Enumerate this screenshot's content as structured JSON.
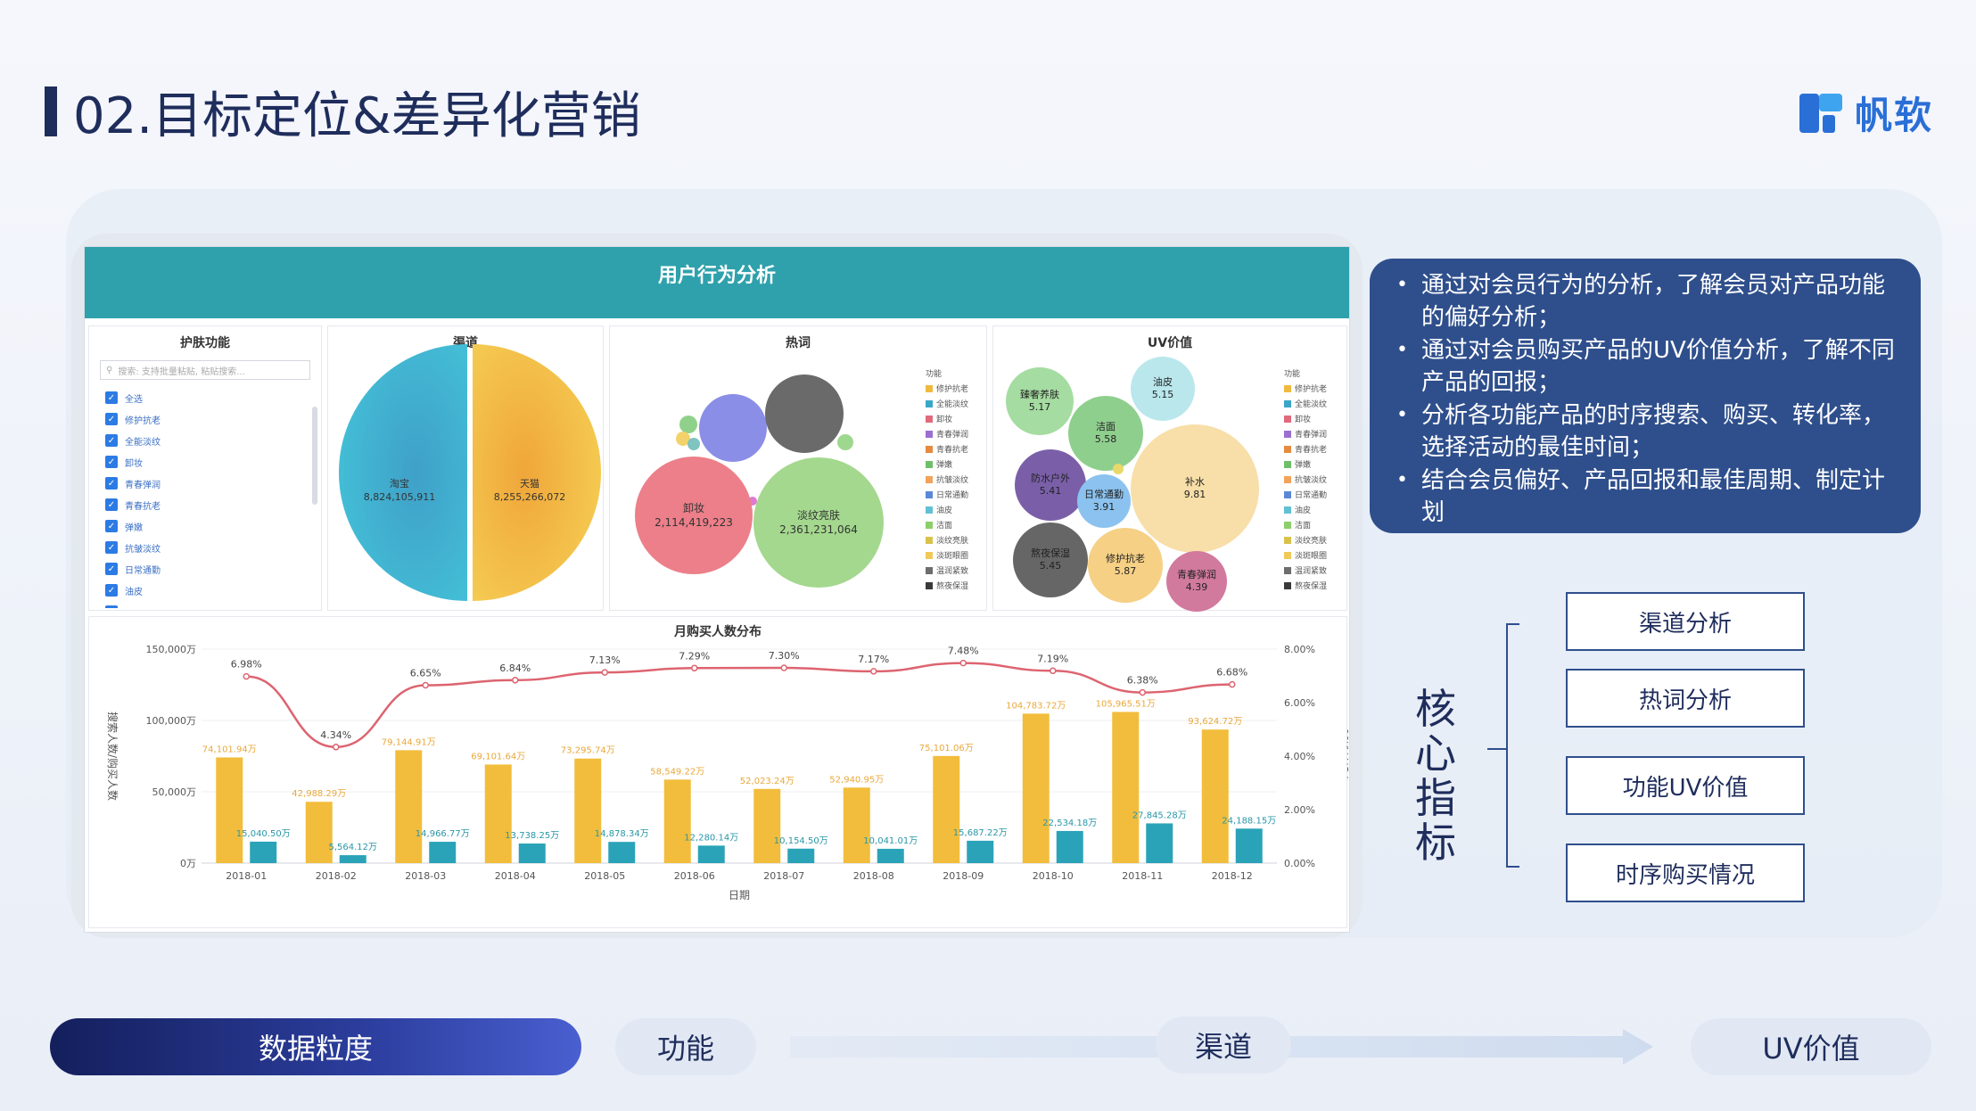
{
  "slide": {
    "title": "02.目标定位&差异化营销",
    "logo_text": "帆软"
  },
  "dashboard": {
    "title": "用户行为分析",
    "filter": {
      "title": "护肤功能",
      "search_placeholder": "搜索: 支持批量粘贴, 粘贴搜索...",
      "items": [
        "全选",
        "修护抗老",
        "全能淡纹",
        "卸妆",
        "青春弹润",
        "青春抗老",
        "弹嫩",
        "抗皱淡纹",
        "日常通勤",
        "油皮",
        "洁面"
      ]
    },
    "channel": {
      "title": "渠道",
      "slices": [
        {
          "label": "淘宝",
          "value": "8,824,105,911"
        },
        {
          "label": "天猫",
          "value": "8,255,266,072"
        }
      ]
    },
    "hotwords": {
      "title": "热词",
      "legend_title": "功能",
      "bubbles": [
        {
          "label": "卸妆",
          "value": "2,114,419,223"
        },
        {
          "label": "淡纹亮肤",
          "value": "2,361,231,064"
        }
      ]
    },
    "uv": {
      "title": "UV价值",
      "legend_title": "功能",
      "bubbles": [
        {
          "label": "臻奢养肤",
          "value": "5.17"
        },
        {
          "label": "油皮",
          "value": "5.15"
        },
        {
          "label": "洁面",
          "value": "5.58"
        },
        {
          "label": "防水户外",
          "value": "5.41"
        },
        {
          "label": "日常通勤",
          "value": "3.91"
        },
        {
          "label": "补水",
          "value": "9.81"
        },
        {
          "label": "熬夜保湿",
          "value": "5.45"
        },
        {
          "label": "修护抗老",
          "value": "5.87"
        },
        {
          "label": "青春弹润",
          "value": "4.39"
        }
      ]
    },
    "legend_items": [
      "修护抗老",
      "全能淡纹",
      "卸妆",
      "青春弹润",
      "青春抗老",
      "弹嫩",
      "抗皱淡纹",
      "日常通勤",
      "油皮",
      "洁面",
      "淡纹亮肤",
      "淡斑眼圈",
      "温润紧致",
      "熬夜保湿"
    ],
    "monthly": {
      "title": "月购买人数分布"
    }
  },
  "colors": {
    "legend": [
      "#f0b93f",
      "#3aa7c7",
      "#e06a7b",
      "#9b6fd0",
      "#e58a3e",
      "#6fbf6a",
      "#f2a35b",
      "#5a88d6",
      "#62c0d4",
      "#8ccf6a",
      "#d8c24a",
      "#f0c95a",
      "#6d6d6d",
      "#3a3a3a"
    ],
    "bar_search": "#f2bd3c",
    "bar_buy": "#2aa3b8",
    "line": "#dd6470",
    "header": "#2fa1ac"
  },
  "chart_data": {
    "type": "bar",
    "title": "月购买人数分布",
    "xlabel": "日期",
    "ylabel": "搜索人数/购买人数",
    "y2label": "支付转化率",
    "ylim": [
      0,
      150000
    ],
    "y2lim": [
      0,
      8
    ],
    "y_ticks": [
      "0万",
      "50,000万",
      "100,000万",
      "150,000万"
    ],
    "y2_ticks": [
      "0.00%",
      "2.00%",
      "4.00%",
      "6.00%",
      "8.00%"
    ],
    "categories": [
      "2018-01",
      "2018-02",
      "2018-03",
      "2018-04",
      "2018-05",
      "2018-06",
      "2018-07",
      "2018-08",
      "2018-09",
      "2018-10",
      "2018-11",
      "2018-12"
    ],
    "series": [
      {
        "name": "搜索人数",
        "values": [
          74101.94,
          42988.29,
          79144.91,
          69101.64,
          73295.74,
          58549.22,
          52023.24,
          52940.95,
          75101.06,
          104783.72,
          105965.51,
          93624.72
        ],
        "labels": [
          "74,101.94万",
          "42,988.29万",
          "79,144.91万",
          "69,101.64万",
          "73,295.74万",
          "58,549.22万",
          "52,023.24万",
          "52,940.95万",
          "75,101.06万",
          "104,783.72万",
          "105,965.51万",
          "93,624.72万"
        ]
      },
      {
        "name": "购买人数",
        "values": [
          15040.5,
          5564.12,
          14966.77,
          13738.25,
          14878.34,
          12280.14,
          10154.5,
          10041.01,
          15687.22,
          22534.18,
          27845.28,
          24188.15
        ],
        "labels": [
          "15,040.50万",
          "5,564.12万",
          "14,966.77万",
          "13,738.25万",
          "14,878.34万",
          "12,280.14万",
          "10,154.50万",
          "10,041.01万",
          "15,687.22万",
          "22,534.18万",
          "27,845.28万",
          "24,188.15万"
        ]
      },
      {
        "name": "支付转化率",
        "axis": "right",
        "values": [
          6.98,
          4.34,
          6.65,
          6.84,
          7.13,
          7.29,
          7.3,
          7.17,
          7.48,
          7.19,
          6.38,
          6.68
        ],
        "labels": [
          "6.98%",
          "4.34%",
          "6.65%",
          "6.84%",
          "7.13%",
          "7.29%",
          "7.30%",
          "7.17%",
          "7.48%",
          "7.19%",
          "6.38%",
          "6.68%"
        ]
      }
    ]
  },
  "info_points": [
    "通过对会员行为的分析，了解会员对产品功能的偏好分析；",
    "通过对会员购买产品的UV价值分析，了解不同产品的回报；",
    "分析各功能产品的时序搜索、购买、转化率，选择活动的最佳时间；",
    "结合会员偏好、产品回报和最佳周期、制定计划"
  ],
  "core": {
    "label": "核心指标",
    "metrics": [
      "渠道分析",
      "热词分析",
      "功能UV价值",
      "时序购买情况"
    ]
  },
  "bottom_nav": {
    "primary": "数据粒度",
    "steps": [
      "功能",
      "渠道",
      "UV价值"
    ]
  }
}
